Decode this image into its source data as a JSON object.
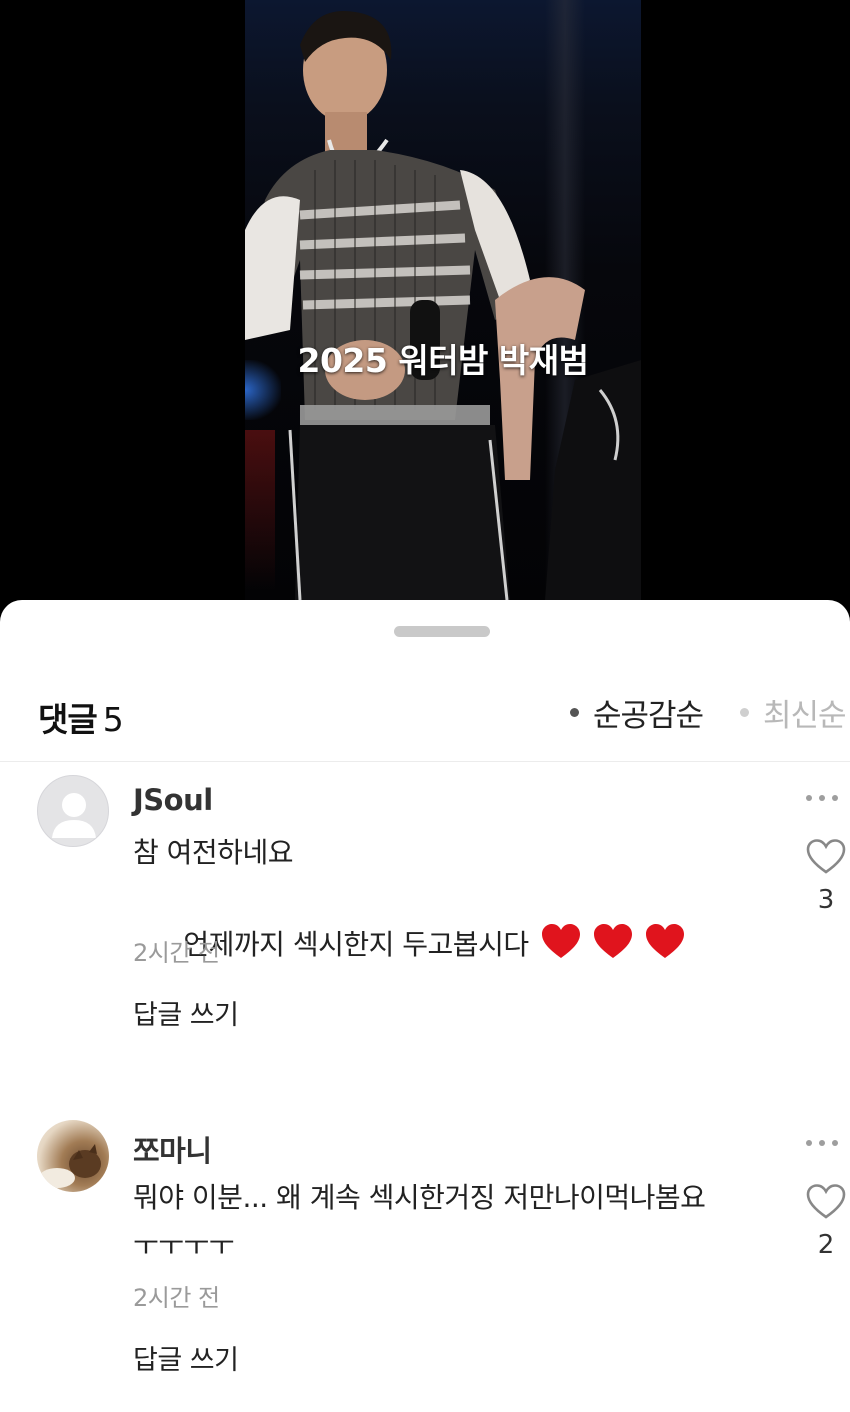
{
  "video": {
    "caption": "2025 워터밤 박재범"
  },
  "comments_panel": {
    "title": "댓글",
    "count": "5",
    "sort_options": [
      "순공감순",
      "최신순"
    ],
    "selected_sort": "순공감순"
  },
  "comments": [
    {
      "nickname": "JSoul",
      "lines": [
        "참 여전하네요",
        "언제까지 섹시한지 두고봅시다"
      ],
      "emoji": "heart-emoji x3",
      "time": "2시간 전",
      "reply_label": "답글 쓰기",
      "likes": "3",
      "avatar": "default-avatar-icon"
    },
    {
      "nickname": "쪼마니",
      "lines": [
        "뭐야 이분... 왜 계속 섹시한거징 저만나이먹나봄요",
        "ㅜㅜㅜㅜ"
      ],
      "time": "2시간 전",
      "reply_label": "답글 쓰기",
      "likes": "2",
      "avatar": "photo-avatar"
    }
  ],
  "colors": {
    "sheet_background": "#ffffff",
    "heart_emoji": "#e0141d",
    "time_text": "#9a9a9a",
    "inactive_sort": "#b8b8b8"
  }
}
